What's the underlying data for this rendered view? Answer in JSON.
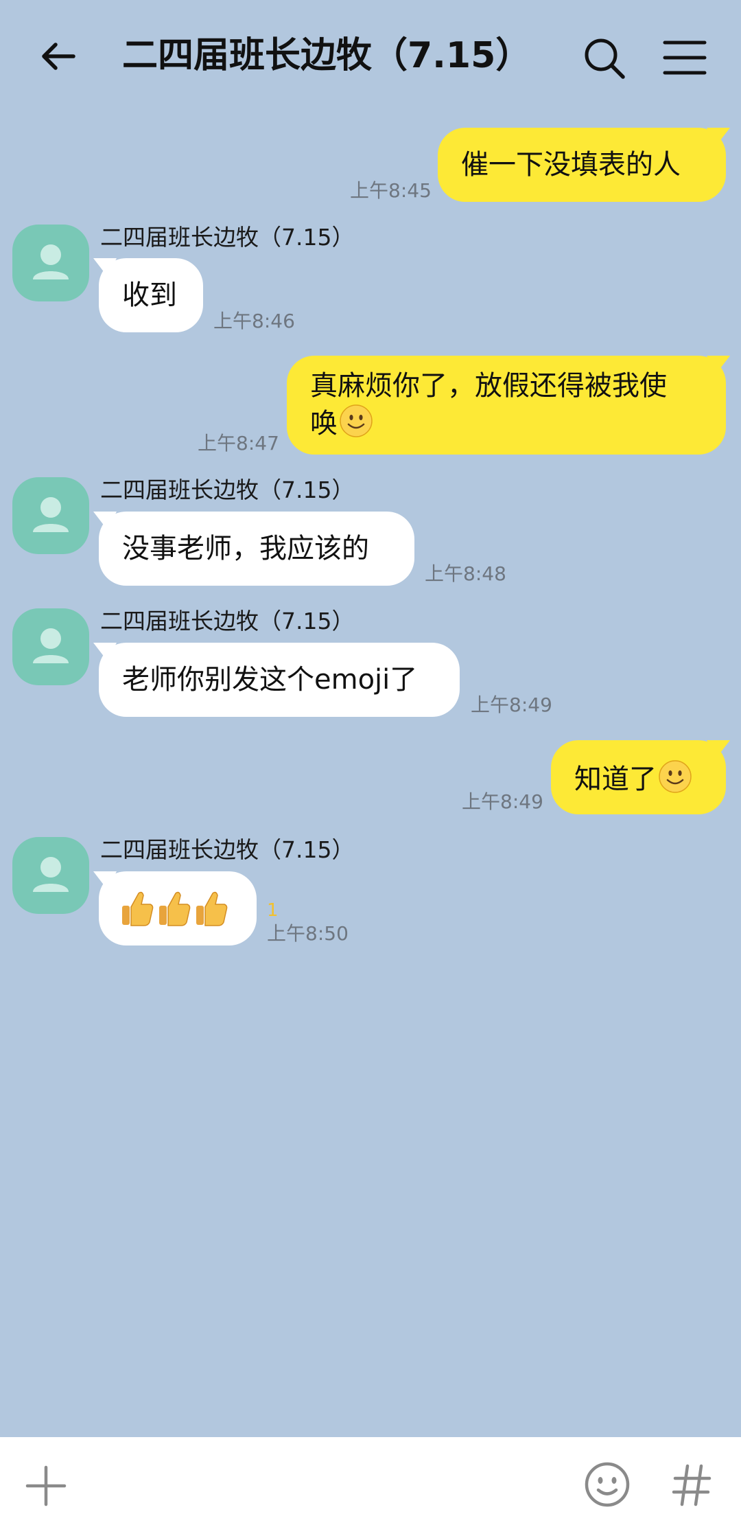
{
  "header": {
    "title": "二四届班长边牧（7.15）",
    "back_icon": "arrow-left-icon",
    "search_icon": "search-icon",
    "menu_icon": "hamburger-menu-icon"
  },
  "messages": [
    {
      "direction": "outgoing",
      "text": "催一下没填表的人",
      "time": "上午8:45"
    },
    {
      "direction": "incoming",
      "sender": "二四届班长边牧（7.15）",
      "text": "收到",
      "time": "上午8:46"
    },
    {
      "direction": "outgoing",
      "line1": "真麻烦你了，放假还得被我使",
      "line2": "唤",
      "emoji": "slightly-smiling-face",
      "time": "上午8:47"
    },
    {
      "direction": "incoming",
      "sender": "二四届班长边牧（7.15）",
      "text": "没事老师，我应该的",
      "time": "上午8:48"
    },
    {
      "direction": "incoming",
      "sender": "二四届班长边牧（7.15）",
      "text": "老师你别发这个emoji了",
      "time": "上午8:49"
    },
    {
      "direction": "outgoing",
      "text": "知道了",
      "emoji": "slightly-smiling-face",
      "time": "上午8:49"
    },
    {
      "direction": "incoming",
      "sender": "二四届班长边牧（7.15）",
      "emoji": "thumbs-up x3",
      "unread_count": "1",
      "time": "上午8:50"
    }
  ],
  "input_bar": {
    "plus_icon": "plus-icon",
    "emoji_icon": "emoji-face-icon",
    "hash_icon": "hash-icon"
  },
  "colors": {
    "background": "#b2c7de",
    "outgoing_bubble": "#fde936",
    "incoming_bubble": "#ffffff",
    "avatar": "#79c8b6",
    "timestamp": "#6e7680"
  }
}
